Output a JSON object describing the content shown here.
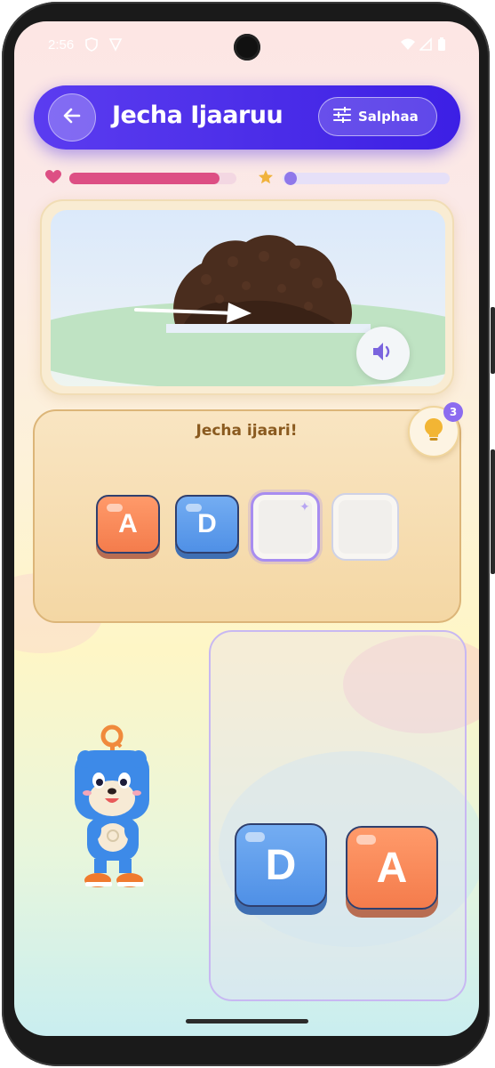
{
  "status_bar": {
    "time": "2:56"
  },
  "header": {
    "title": "Jecha Ijaaruu",
    "settings_label": "Salphaa",
    "colors": {
      "background": "#4b2de8"
    }
  },
  "progress": {
    "hearts_fraction": 0.9,
    "stars_fraction": 0.05,
    "colors": {
      "hearts": "#dd4f84",
      "stars": "#8f78ea"
    }
  },
  "puzzle": {
    "prompt": "Jecha ijaari!",
    "hint_count": "3",
    "slots": [
      "A",
      "D",
      "",
      ""
    ],
    "bank": [
      "D",
      "A"
    ]
  },
  "icons": {
    "back": "arrow-left-icon",
    "settings": "sliders-icon",
    "hearts": "heart-icon",
    "stars": "star-icon",
    "audio": "speaker-icon",
    "hint": "lightbulb-icon"
  }
}
